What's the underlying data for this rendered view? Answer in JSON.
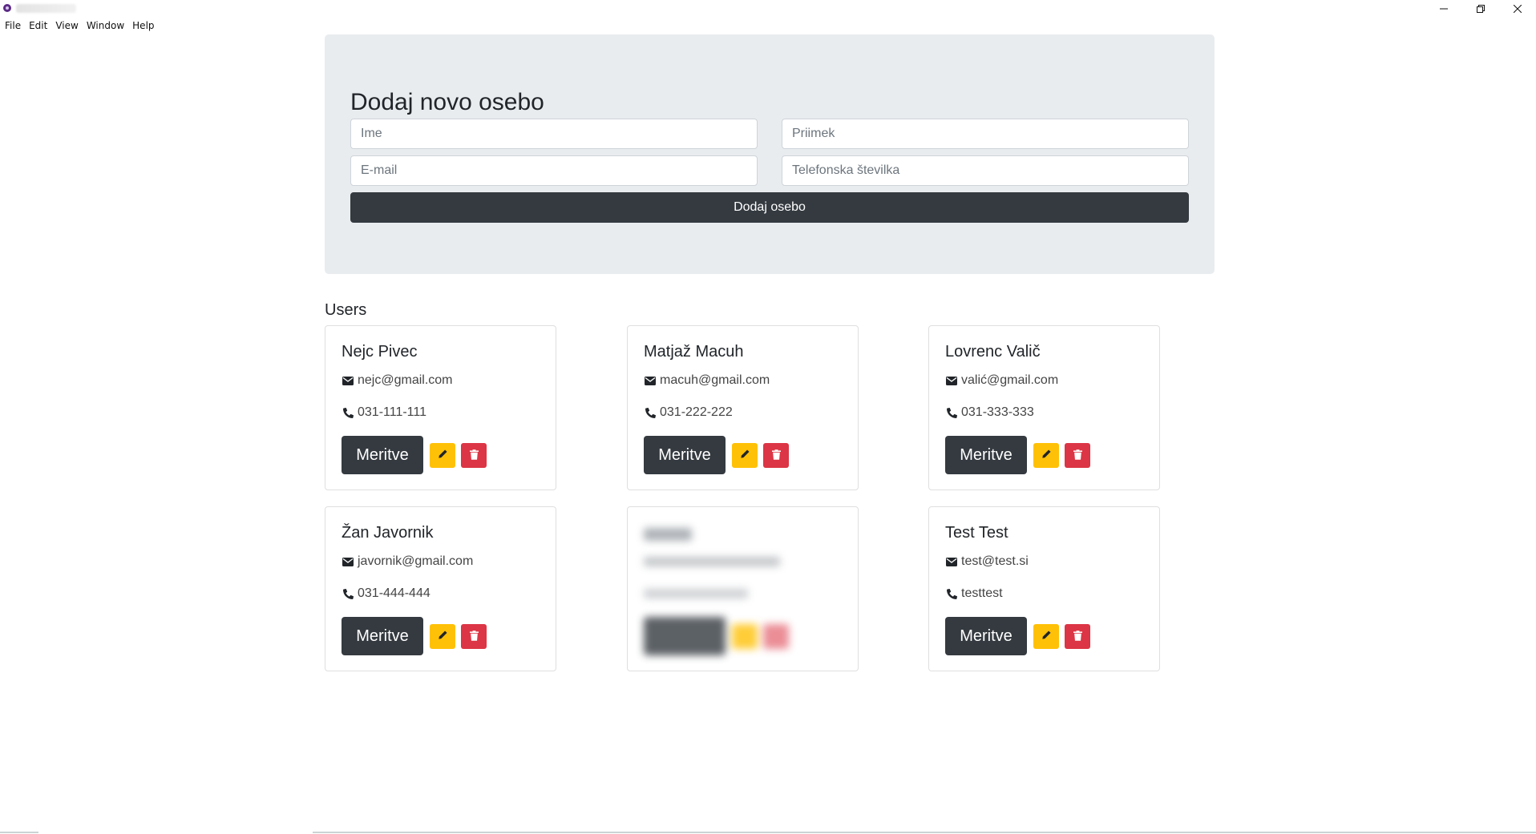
{
  "window": {
    "menu": [
      "File",
      "Edit",
      "View",
      "Window",
      "Help"
    ],
    "controls": [
      "minimize",
      "restore",
      "close"
    ]
  },
  "form": {
    "title": "Dodaj novo osebo",
    "first_name_placeholder": "Ime",
    "last_name_placeholder": "Priimek",
    "email_placeholder": "E-mail",
    "phone_placeholder": "Telefonska številka",
    "submit_label": "Dodaj osebo"
  },
  "users_heading": "Users",
  "users": [
    {
      "name": "Nejc Pivec",
      "email": "nejc@gmail.com",
      "phone": "031-111-111",
      "button": "Meritve"
    },
    {
      "name": "Matjaž Macuh",
      "email": "macuh@gmail.com",
      "phone": "031-222-222",
      "button": "Meritve"
    },
    {
      "name": "Lovrenc Valič",
      "email": "valić@gmail.com",
      "phone": "031-333-333",
      "button": "Meritve"
    },
    {
      "name": "Žan Javornik",
      "email": "javornik@gmail.com",
      "phone": "031-444-444",
      "button": "Meritve"
    },
    {
      "name": "",
      "email": "",
      "phone": "",
      "button": ""
    },
    {
      "name": "Test Test",
      "email": "test@test.si",
      "phone": "testtest",
      "button": "Meritve"
    }
  ],
  "colors": {
    "jumbotron_bg": "#e9ecef",
    "dark_button": "#343a40",
    "edit_button": "#ffc107",
    "delete_button": "#dc3545"
  },
  "icons": {
    "email": "envelope-icon",
    "phone": "phone-icon",
    "edit": "pencil-icon",
    "delete": "trash-icon"
  }
}
